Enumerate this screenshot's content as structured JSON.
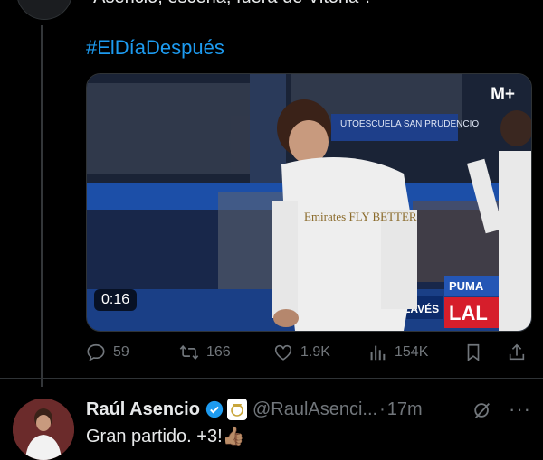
{
  "previous_tweet": {
    "text_fragment": "\"Asencio, escena, fuera de Vitoria\"."
  },
  "hashtag": "#ElDíaDespués",
  "video": {
    "duration": "0:16",
    "broadcaster_logo": "M+",
    "stadium_banner_text": "UTOESCUELA SAN PRUDENCIO",
    "shirt_sponsor": "Emirates FLY BETTER",
    "ad_board_left": "LAVÉS",
    "ad_board_right": "LAL",
    "ad_board_top": "PUMA"
  },
  "actions": {
    "replies": "59",
    "reposts": "166",
    "likes": "1.9K",
    "views": "154K"
  },
  "next_tweet": {
    "display_name": "Raúl Asencio",
    "handle": "@RaulAsenci...",
    "separator": "·",
    "time": "17m",
    "text": "Gran partido. +3!👍🏽",
    "more": "···"
  },
  "colors": {
    "background": "#000000",
    "link": "#1d9bf0",
    "muted": "#71767b",
    "verified": "#1d9bf0"
  }
}
